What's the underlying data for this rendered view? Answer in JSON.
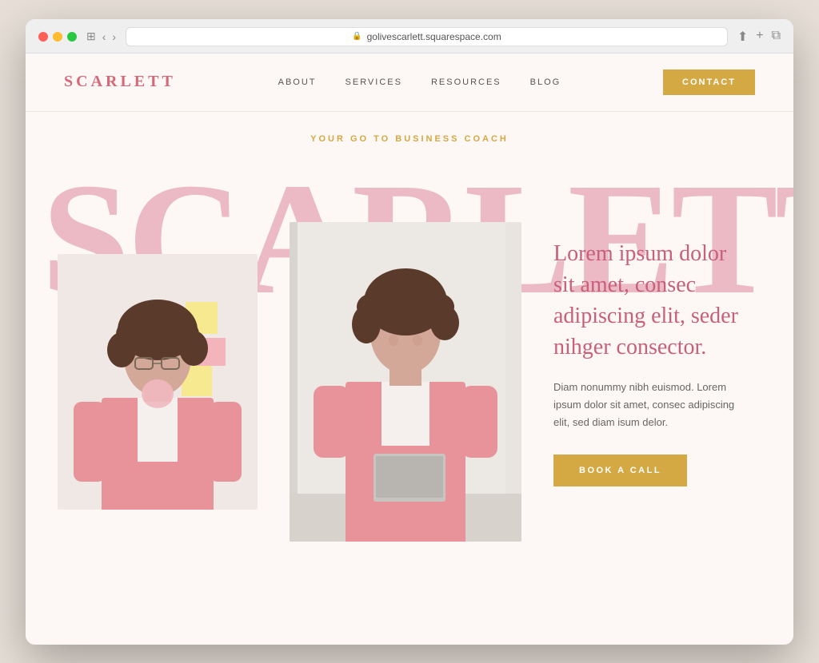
{
  "browser": {
    "url": "golivescarlett.squarespace.com",
    "back_label": "‹",
    "forward_label": "›"
  },
  "header": {
    "logo": "SCARLETT",
    "nav": {
      "items": [
        {
          "label": "ABOUT"
        },
        {
          "label": "SERVICES"
        },
        {
          "label": "RESOURCES"
        },
        {
          "label": "BLOG"
        }
      ]
    },
    "contact_button": "CONTACT"
  },
  "hero": {
    "tagline": "YOUR GO TO BUSINESS COACH",
    "bg_text": "SCARLETT",
    "headline": "Lorem ipsum dolor sit amet, consec adipiscing elit, seder nihger consector.",
    "body": "Diam nonummy nibh euismod. Lorem ipsum dolor sit amet, consec adipiscing elit, sed diam isum delor.",
    "book_button": "BOOK A CALL",
    "photo_left_alt": "Woman in pink blazer blowing bubblegum",
    "photo_center_alt": "Woman in pink suit holding laptop"
  },
  "colors": {
    "brand_pink": "#d4697a",
    "brand_gold": "#d4a843",
    "bg_light": "#fdf8f5",
    "text_pink": "#c8607a",
    "text_bg": "#e8b0bc"
  }
}
